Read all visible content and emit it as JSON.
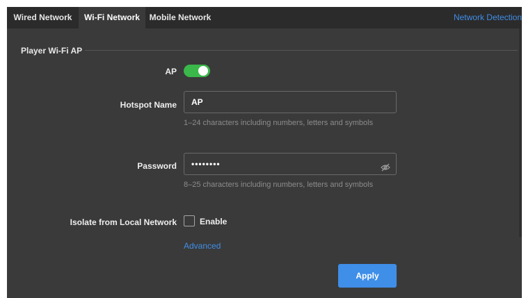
{
  "tabs": [
    {
      "label": "Wired Network"
    },
    {
      "label": "Wi-Fi Network"
    },
    {
      "label": "Mobile Network"
    }
  ],
  "active_tab": "Wi-Fi Network",
  "network_detection_label": "Network Detection",
  "section": {
    "title": "Player Wi-Fi AP"
  },
  "ap": {
    "label": "AP",
    "enabled": true
  },
  "hotspot": {
    "label": "Hotspot Name",
    "value": "AP",
    "hint": "1–24 characters including numbers, letters and symbols"
  },
  "password": {
    "label": "Password",
    "value": "••••••••",
    "hint": "8–25 characters including numbers, letters and symbols",
    "visibility_icon": "eye-slash-icon"
  },
  "isolate": {
    "label": "Isolate from Local Network",
    "checkbox_label": "Enable",
    "checked": false
  },
  "advanced_label": "Advanced",
  "apply_label": "Apply",
  "colors": {
    "accent": "#3f8ee8",
    "toggle_on": "#3ab84a",
    "panel_bg": "#3a3a3a",
    "tabbar_bg": "#2b2b2b"
  }
}
